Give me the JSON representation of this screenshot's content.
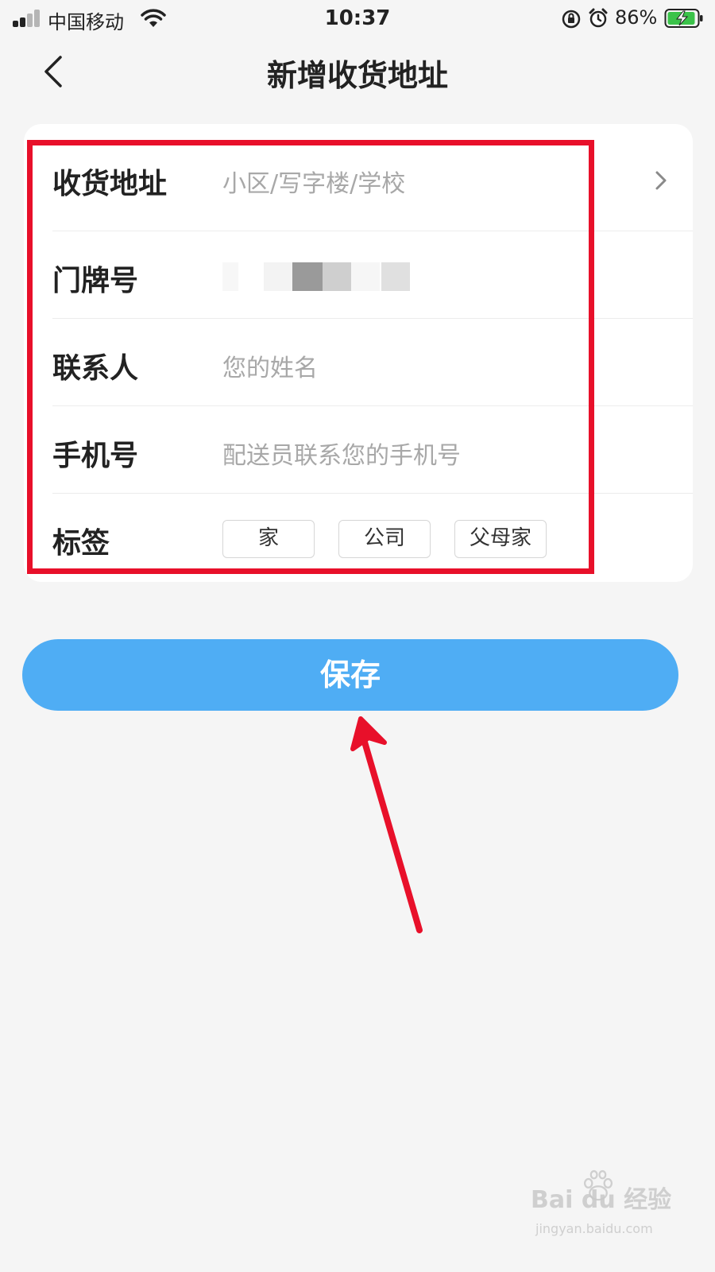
{
  "status_bar": {
    "carrier": "中国移动",
    "time": "10:37",
    "battery_percent": "86%",
    "icons": [
      "signal-icon",
      "wifi-icon",
      "rotation-lock-icon",
      "alarm-icon",
      "battery-charging-icon"
    ]
  },
  "nav": {
    "back_icon": "chevron-left-icon",
    "title": "新增收货地址"
  },
  "form": {
    "address": {
      "label": "收货地址",
      "placeholder": "小区/写字楼/学校"
    },
    "door_number": {
      "label": "门牌号"
    },
    "contact": {
      "label": "联系人",
      "placeholder": "您的姓名"
    },
    "phone": {
      "label": "手机号",
      "placeholder": "配送员联系您的手机号"
    },
    "tags": {
      "label": "标签",
      "options": [
        "家",
        "公司",
        "父母家"
      ]
    }
  },
  "save_button": {
    "label": "保存"
  },
  "colors": {
    "accent": "#4fadf4",
    "highlight": "#e8102a",
    "background": "#f5f5f5"
  },
  "watermark": {
    "brand": "Bai du 经验",
    "url": "jingyan.baidu.com"
  }
}
